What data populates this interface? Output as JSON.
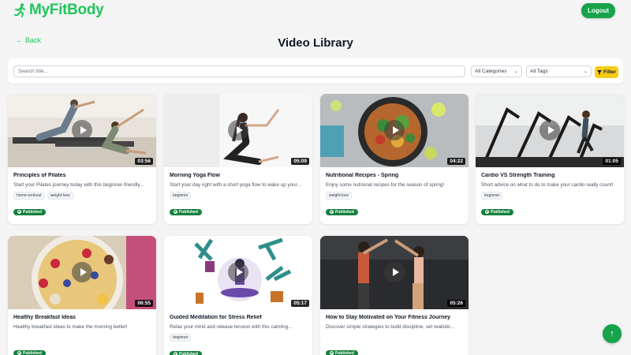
{
  "app": {
    "name": "MyFitBody",
    "logout_label": "Logout"
  },
  "nav": {
    "back_label": "Back"
  },
  "page": {
    "title": "Video Library"
  },
  "filters": {
    "search_placeholder": "Search title...",
    "category_value": "All Categories",
    "tag_value": "All Tags",
    "filter_label": "Filter"
  },
  "colors": {
    "brand": "#22c55e",
    "logout": "#16a34a",
    "filter": "#facc15",
    "published": "#15803d"
  },
  "videos": [
    {
      "title": "Principles of Pilates",
      "desc": "Start your Pilates journey today with this beginner-friendly...",
      "tags": [
        "home-workout",
        "weight-loss"
      ],
      "duration": "03:56",
      "status": "Published",
      "thumb": "pilates"
    },
    {
      "title": "Morning Yoga Flow",
      "desc": "Start your day right with a short yoga flow to wake up your...",
      "tags": [
        "beginner"
      ],
      "duration": "05:09",
      "status": "Published",
      "thumb": "yoga"
    },
    {
      "title": "Nutritional Recipes - Spring",
      "desc": "Enjoy some nutrional recipes for the season of spring!",
      "tags": [
        "weight-loss"
      ],
      "duration": "04:22",
      "status": "Published",
      "thumb": "recipes"
    },
    {
      "title": "Cardio VS Strength Training",
      "desc": "Short advice on what to do to make your cardio really count!",
      "tags": [
        "beginner"
      ],
      "duration": "01:05",
      "status": "Published",
      "thumb": "cardio"
    },
    {
      "title": "Healthy Breakfast Ideas",
      "desc": "Healthy breakfast ideas to make the morning better!",
      "tags": [],
      "duration": "06:55",
      "status": "Published",
      "thumb": "breakfast"
    },
    {
      "title": "Guided Meditation for Stress Relief",
      "desc": "Relax your mind and release tension with this calming...",
      "tags": [
        "beginner"
      ],
      "duration": "05:17",
      "status": "Published",
      "thumb": "meditation"
    },
    {
      "title": "How to Stay Motivated on Your Fitness Journey",
      "desc": "Discover simple strategies to build discipline, set realistic...",
      "tags": [],
      "duration": "05:26",
      "status": "Published",
      "thumb": "motivation"
    }
  ]
}
